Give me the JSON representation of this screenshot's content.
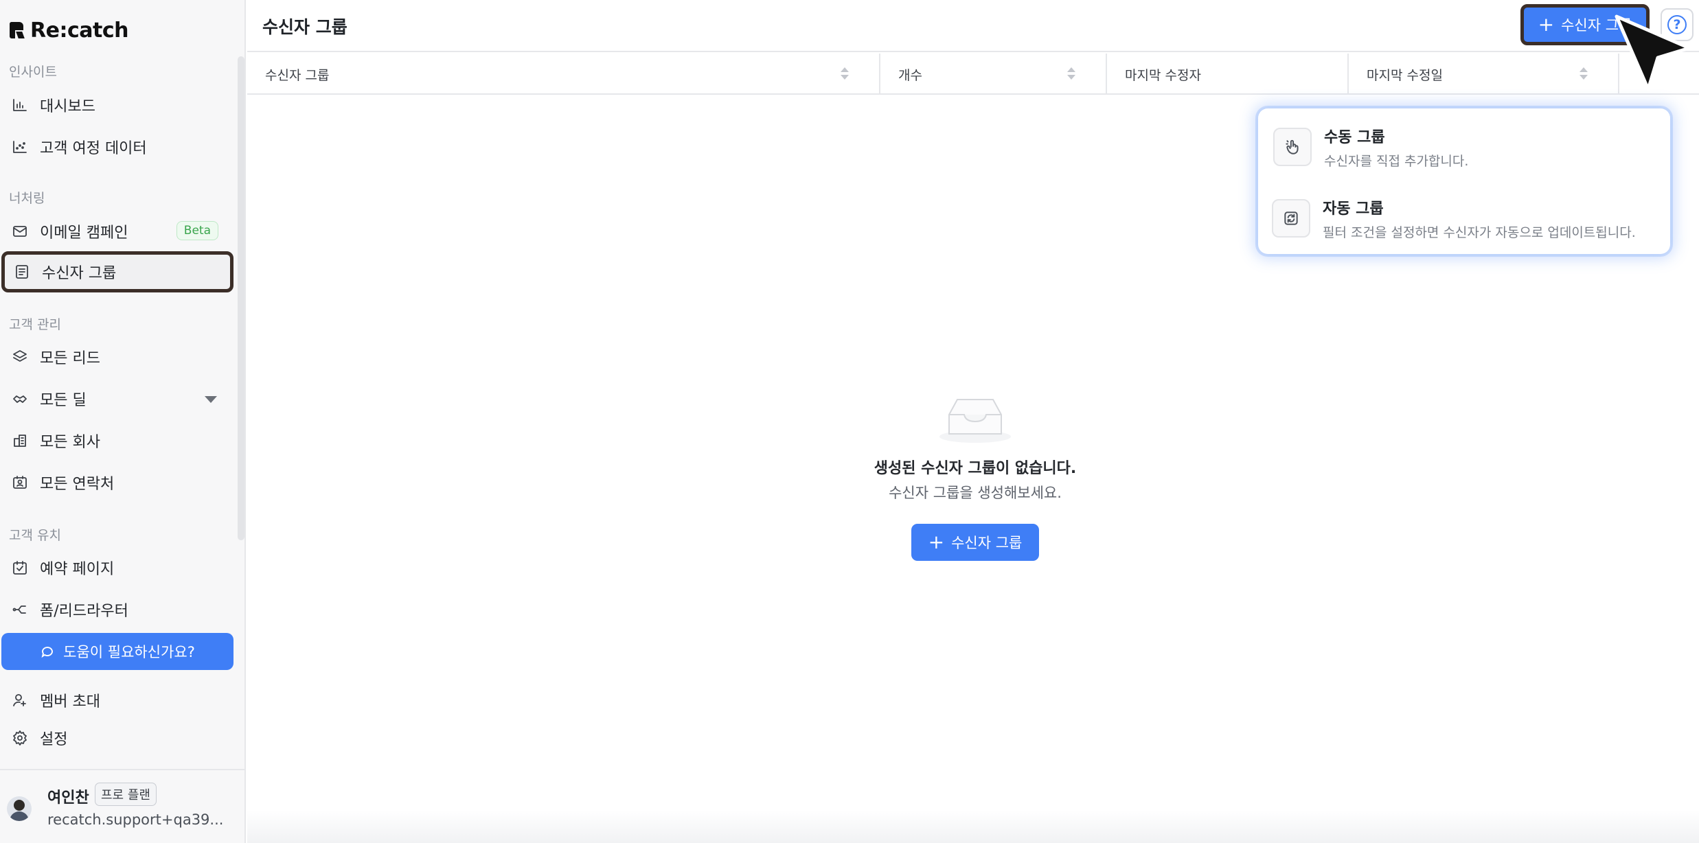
{
  "app": {
    "logo_text": "Re:catch"
  },
  "sidebar": {
    "sections": {
      "insight": "인사이트",
      "nurturing": "너처링",
      "customer_mgmt": "고객 관리",
      "customer_acq": "고객 유치"
    },
    "items": {
      "dashboard": "대시보드",
      "journey": "고객 여정 데이터",
      "email": "이메일 캠페인",
      "email_badge": "Beta",
      "recipients": "수신자 그룹",
      "leads": "모든 리드",
      "deals": "모든 딜",
      "companies": "모든 회사",
      "contacts": "모든 연락처",
      "booking": "예약 페이지",
      "forms": "폼/리드라우터",
      "invite": "멤버 초대",
      "settings": "설정"
    },
    "help_button": "도움이 필요하신가요?",
    "profile": {
      "name": "여인찬",
      "plan": "프로 플랜",
      "email": "recatch.support+qa39..."
    }
  },
  "header": {
    "title": "수신자 그룹",
    "add_button": "수신자 그룹",
    "help_icon": "?"
  },
  "table": {
    "columns": [
      "수신자 그룹",
      "개수",
      "마지막 수정자",
      "마지막 수정일"
    ]
  },
  "empty_state": {
    "title": "생성된 수신자 그룹이 없습니다.",
    "subtitle": "수신자 그룹을 생성해보세요.",
    "button": "수신자 그룹"
  },
  "dropdown": {
    "items": [
      {
        "title": "수동 그룹",
        "desc": "수신자를 직접 추가합니다.",
        "icon": "hand-pointer-icon"
      },
      {
        "title": "자동 그룹",
        "desc": "필터 조건을 설정하면 수신자가 자동으로 업데이트됩니다.",
        "icon": "auto-refresh-icon"
      }
    ]
  },
  "colors": {
    "accent": "#3f7ef6",
    "highlight_border": "#3b2e28",
    "beta_green": "#3aa54d"
  }
}
